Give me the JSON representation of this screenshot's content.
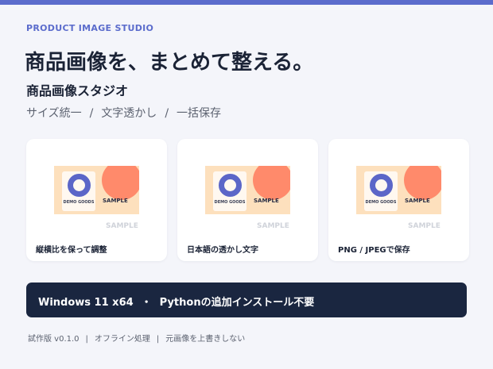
{
  "brand": {
    "accent": "#5b6ccc",
    "dark": "#1a2640",
    "eyebrow": "PRODUCT IMAGE STUDIO"
  },
  "hero": {
    "headline": "商品画像を、まとめて整える。",
    "subtitle": "商品画像スタジオ",
    "features": [
      "サイズ統一",
      "文字透かし",
      "一括保存"
    ],
    "separator": "/"
  },
  "cards": [
    {
      "caption": "縦横比を保って調整",
      "demo_label": "DEMO GOODS",
      "sample_label": "SAMPLE",
      "watermark": "SAMPLE",
      "icons": [
        "demo-product-ring-icon",
        "sun-icon"
      ]
    },
    {
      "caption": "日本語の透かし文字",
      "demo_label": "DEMO GOODS",
      "sample_label": "SAMPLE",
      "watermark": "SAMPLE",
      "icons": [
        "demo-product-ring-icon",
        "sun-icon"
      ]
    },
    {
      "caption": "PNG / JPEGで保存",
      "demo_label": "DEMO GOODS",
      "sample_label": "SAMPLE",
      "watermark": "SAMPLE",
      "icons": [
        "demo-product-ring-icon",
        "sun-icon"
      ]
    }
  ],
  "banner": {
    "left": "Windows 11 x64",
    "dot": "・",
    "right": "Pythonの追加インストール不要"
  },
  "footer": {
    "items": [
      "試作版 v0.1.0",
      "オフライン処理",
      "元画像を上書きしない"
    ],
    "separator": "|"
  }
}
